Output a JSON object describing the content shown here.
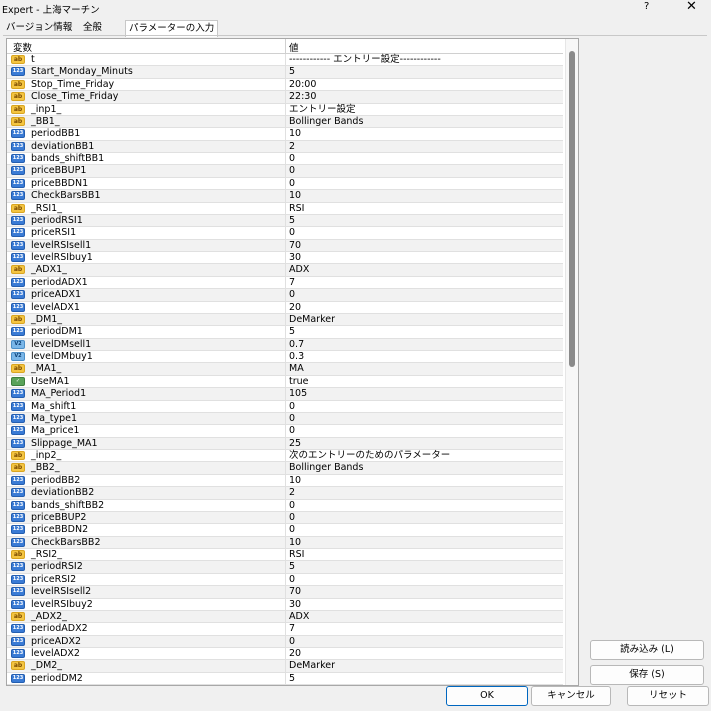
{
  "window": {
    "title": "Expert - 上海マーチン",
    "help": "?",
    "close": "✕"
  },
  "tabs": [
    {
      "label": "バージョン情報"
    },
    {
      "label": "全般"
    },
    {
      "label": "パラメーターの入力"
    }
  ],
  "grid": {
    "col_variable": "変数",
    "col_value": "値",
    "rows": [
      {
        "type": "str",
        "name": "t",
        "value": "------------ エントリー設定------------"
      },
      {
        "type": "int",
        "name": "Start_Monday_Minuts",
        "value": "5"
      },
      {
        "type": "str",
        "name": "Stop_Time_Friday",
        "value": "20:00"
      },
      {
        "type": "str",
        "name": "Close_Time_Friday",
        "value": "22:30"
      },
      {
        "type": "str",
        "name": "_inp1_",
        "value": "エントリー設定"
      },
      {
        "type": "str",
        "name": "_BB1_",
        "value": "Bollinger Bands"
      },
      {
        "type": "int",
        "name": "periodBB1",
        "value": "10"
      },
      {
        "type": "int",
        "name": "deviationBB1",
        "value": "2"
      },
      {
        "type": "int",
        "name": "bands_shiftBB1",
        "value": "0"
      },
      {
        "type": "int",
        "name": "priceBBUP1",
        "value": "0"
      },
      {
        "type": "int",
        "name": "priceBBDN1",
        "value": "0"
      },
      {
        "type": "int",
        "name": "CheckBarsBB1",
        "value": "10"
      },
      {
        "type": "str",
        "name": "_RSI1_",
        "value": "RSI"
      },
      {
        "type": "int",
        "name": "periodRSI1",
        "value": "5"
      },
      {
        "type": "int",
        "name": "priceRSI1",
        "value": "0"
      },
      {
        "type": "int",
        "name": "levelRSIsell1",
        "value": "70"
      },
      {
        "type": "int",
        "name": "levelRSIbuy1",
        "value": "30"
      },
      {
        "type": "str",
        "name": "_ADX1_",
        "value": "ADX"
      },
      {
        "type": "int",
        "name": "periodADX1",
        "value": "7"
      },
      {
        "type": "int",
        "name": "priceADX1",
        "value": "0"
      },
      {
        "type": "int",
        "name": "levelADX1",
        "value": "20"
      },
      {
        "type": "str",
        "name": "_DM1_",
        "value": "DeMarker"
      },
      {
        "type": "int",
        "name": "periodDM1",
        "value": "5"
      },
      {
        "type": "dbl",
        "name": "levelDMsell1",
        "value": "0.7"
      },
      {
        "type": "dbl",
        "name": "levelDMbuy1",
        "value": "0.3"
      },
      {
        "type": "str",
        "name": "_MA1_",
        "value": "MA"
      },
      {
        "type": "bool",
        "name": "UseMA1",
        "value": "true"
      },
      {
        "type": "int",
        "name": "MA_Period1",
        "value": "105"
      },
      {
        "type": "int",
        "name": "Ma_shift1",
        "value": "0"
      },
      {
        "type": "int",
        "name": "Ma_type1",
        "value": "0"
      },
      {
        "type": "int",
        "name": "Ma_price1",
        "value": "0"
      },
      {
        "type": "int",
        "name": "Slippage_MA1",
        "value": "25"
      },
      {
        "type": "str",
        "name": "_inp2_",
        "value": "次のエントリーのためのパラメーター"
      },
      {
        "type": "str",
        "name": "_BB2_",
        "value": "Bollinger Bands"
      },
      {
        "type": "int",
        "name": "periodBB2",
        "value": "10"
      },
      {
        "type": "int",
        "name": "deviationBB2",
        "value": "2"
      },
      {
        "type": "int",
        "name": "bands_shiftBB2",
        "value": "0"
      },
      {
        "type": "int",
        "name": "priceBBUP2",
        "value": "0"
      },
      {
        "type": "int",
        "name": "priceBBDN2",
        "value": "0"
      },
      {
        "type": "int",
        "name": "CheckBarsBB2",
        "value": "10"
      },
      {
        "type": "str",
        "name": "_RSI2_",
        "value": "RSI"
      },
      {
        "type": "int",
        "name": "periodRSI2",
        "value": "5"
      },
      {
        "type": "int",
        "name": "priceRSI2",
        "value": "0"
      },
      {
        "type": "int",
        "name": "levelRSIsell2",
        "value": "70"
      },
      {
        "type": "int",
        "name": "levelRSIbuy2",
        "value": "30"
      },
      {
        "type": "str",
        "name": "_ADX2_",
        "value": "ADX"
      },
      {
        "type": "int",
        "name": "periodADX2",
        "value": "7"
      },
      {
        "type": "int",
        "name": "priceADX2",
        "value": "0"
      },
      {
        "type": "int",
        "name": "levelADX2",
        "value": "20"
      },
      {
        "type": "str",
        "name": "_DM2_",
        "value": "DeMarker"
      },
      {
        "type": "int",
        "name": "periodDM2",
        "value": "5"
      }
    ]
  },
  "icon_labels": {
    "str": "ab",
    "int": "123",
    "dbl": "V2",
    "bool": "✓"
  },
  "buttons": {
    "load": "読み込み (L)",
    "save": "保存 (S)",
    "ok": "OK",
    "cancel": "キャンセル",
    "reset": "リセット"
  }
}
